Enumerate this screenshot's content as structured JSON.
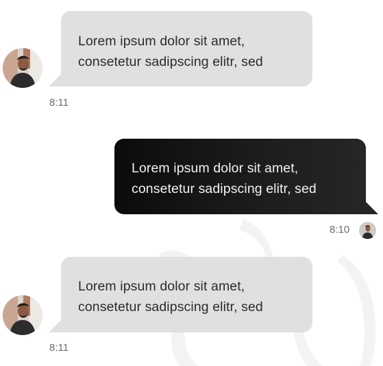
{
  "messages": [
    {
      "direction": "incoming",
      "lines": [
        "Lorem ipsum dolor sit amet,",
        "consetetur sadipscing elitr, sed"
      ],
      "time": "8:11",
      "avatar": "user-avatar-photo"
    },
    {
      "direction": "outgoing",
      "lines": [
        "Lorem ipsum dolor sit amet,",
        "consetetur sadipscing elitr, sed"
      ],
      "time": "8:10",
      "avatar": "user-avatar-photo"
    },
    {
      "direction": "incoming",
      "lines": [
        "Lorem ipsum dolor sit amet,",
        "consetetur sadipscing elitr, sed"
      ],
      "time": "8:11",
      "avatar": "user-avatar-photo"
    }
  ],
  "colors": {
    "incoming_bubble": "#dfe0df",
    "outgoing_bubble": "#111111",
    "incoming_text": "#2b2b2b",
    "outgoing_text": "#f2f2f2",
    "timestamp": "#6b6b6b"
  }
}
